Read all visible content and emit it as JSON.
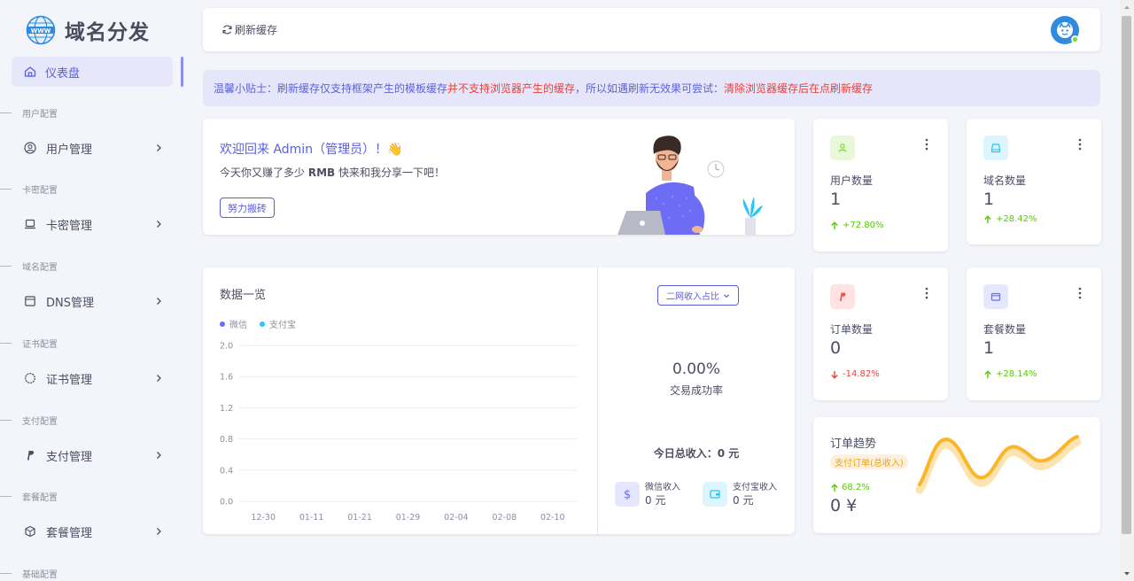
{
  "brand": {
    "name": "域名分发",
    "logo_icon": "www-globe-icon"
  },
  "sidebar": {
    "active": {
      "label": "仪表盘",
      "icon": "home-icon"
    },
    "sections": [
      {
        "title": "用户配置",
        "item": {
          "label": "用户管理",
          "icon": "user-circle-icon"
        }
      },
      {
        "title": "卡密配置",
        "item": {
          "label": "卡密管理",
          "icon": "laptop-icon"
        }
      },
      {
        "title": "域名配置",
        "item": {
          "label": "DNS管理",
          "icon": "window-icon"
        }
      },
      {
        "title": "证书配置",
        "item": {
          "label": "证书管理",
          "icon": "cert-icon"
        }
      },
      {
        "title": "支付配置",
        "item": {
          "label": "支付管理",
          "icon": "paypal-icon"
        }
      },
      {
        "title": "套餐配置",
        "item": {
          "label": "套餐管理",
          "icon": "package-icon"
        }
      },
      {
        "title": "基础配置"
      }
    ]
  },
  "topbar": {
    "refresh_label": "刷新缓存"
  },
  "tip": {
    "part1": "温馨小贴士：刷新缓存仅支持框架产生的模板缓存",
    "part2": "并不支持浏览器产生的缓存",
    "part3": "，所以如遇刷新无效果可尝试：",
    "part4": "清除浏览器缓存后在点刷新缓存"
  },
  "welcome": {
    "title": "欢迎回来 Admin（管理员）！👋",
    "sub_prefix": "今天你又赚了多少 ",
    "sub_bold": "RMB",
    "sub_suffix": " 快来和我分享一下吧！",
    "button": "努力搬砖"
  },
  "stats": {
    "users": {
      "label": "用户数量",
      "value": "1",
      "trend": "+72.80%",
      "color": "#72e128"
    },
    "domains": {
      "label": "域名数量",
      "value": "1",
      "trend": "+28.42%",
      "color": "#26c6f9"
    },
    "orders": {
      "label": "订单数量",
      "value": "0",
      "trend": "-14.82%",
      "color": "#ff4d49"
    },
    "packages": {
      "label": "套餐数量",
      "value": "1",
      "trend": "+28.14%",
      "color": "#666cff"
    }
  },
  "data_overview": {
    "title": "数据一览",
    "dropdown": "二网收入占比",
    "rate": "0.00%",
    "rate_label": "交易成功率",
    "total": "今日总收入：0 元",
    "wechat": {
      "label": "微信收入",
      "value": "0 元",
      "icon": "dollar-icon"
    },
    "alipay": {
      "label": "支付宝收入",
      "value": "0 元",
      "icon": "wallet-icon"
    }
  },
  "chart_data": {
    "type": "bar",
    "categories": [
      "12-30",
      "01-11",
      "01-21",
      "01-29",
      "02-04",
      "02-08",
      "02-10"
    ],
    "series": [
      {
        "name": "微信",
        "values": [
          0,
          0,
          0,
          0,
          0,
          0,
          0
        ],
        "color": "#666cff"
      },
      {
        "name": "支付宝",
        "values": [
          0,
          0,
          0,
          0,
          0,
          0,
          0
        ],
        "color": "#26c6f9"
      }
    ],
    "yticks": [
      "2.0",
      "1.6",
      "1.2",
      "0.8",
      "0.4",
      "0.0"
    ],
    "ylim": [
      0,
      2.0
    ],
    "grid": true,
    "legend": "top-left"
  },
  "order_trend": {
    "title": "订单趋势",
    "tag": "支付订单(总收入)",
    "pct": "68.2%",
    "value": "0 ¥",
    "color": "#fdb528"
  }
}
